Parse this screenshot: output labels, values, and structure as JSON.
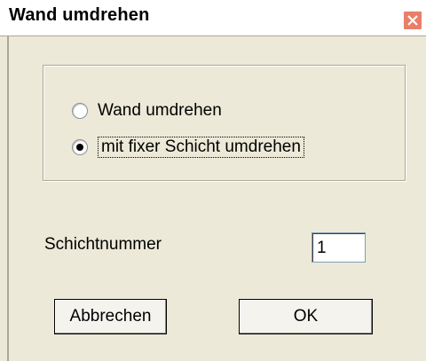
{
  "window": {
    "title": "Wand umdrehen"
  },
  "options": {
    "items": [
      {
        "label": "Wand umdrehen",
        "selected": false
      },
      {
        "label": "mit fixer Schicht umdrehen",
        "selected": true
      }
    ]
  },
  "layer": {
    "label": "Schichtnummer",
    "value": "1"
  },
  "buttons": {
    "cancel_label": "Abbrechen",
    "ok_label": "OK"
  },
  "icons": {
    "close": "close-icon"
  },
  "colors": {
    "dialog_bg": "#ece9d8",
    "close_button": "#e87f68"
  }
}
